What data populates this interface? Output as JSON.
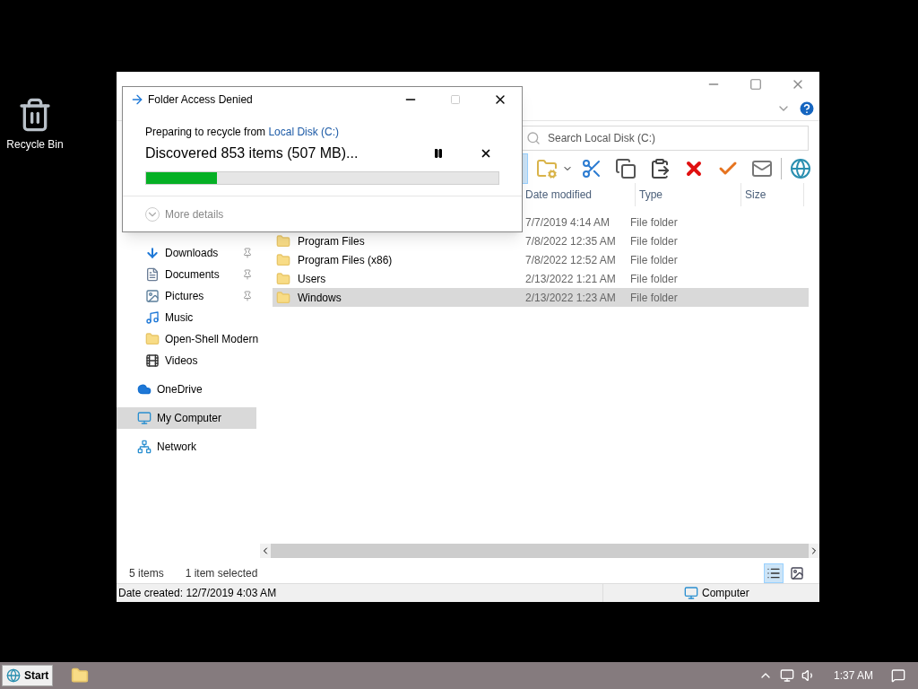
{
  "desktop_icons": [
    {
      "label": "Recycle Bin"
    }
  ],
  "explorer": {
    "search": {
      "placeholder": "Search Local Disk (C:)"
    },
    "toolbar": [
      {
        "kind": "pane",
        "selected": true
      },
      {
        "kind": "properties"
      },
      {
        "kind": "cut"
      },
      {
        "kind": "copy"
      },
      {
        "kind": "paste"
      },
      {
        "kind": "delete"
      },
      {
        "kind": "check"
      },
      {
        "kind": "mail"
      },
      {
        "kind": "globe"
      }
    ],
    "columns": [
      "Date modified",
      "Type",
      "Size"
    ],
    "sidebar": [
      {
        "label": "Downloads",
        "kind": "download",
        "pinned": true,
        "selected": false
      },
      {
        "label": "Documents",
        "kind": "document",
        "pinned": true,
        "selected": false
      },
      {
        "label": "Pictures",
        "kind": "picture",
        "pinned": true,
        "selected": false
      },
      {
        "label": "Music",
        "kind": "music",
        "pinned": false,
        "selected": false
      },
      {
        "label": "Open-Shell Modern",
        "kind": "folder",
        "pinned": false,
        "selected": false
      },
      {
        "label": "Videos",
        "kind": "video",
        "pinned": false,
        "selected": false
      },
      {
        "label": "OneDrive",
        "kind": "cloud",
        "pinned": false,
        "selected": false,
        "gap": true
      },
      {
        "label": "My Computer",
        "kind": "computer",
        "pinned": false,
        "selected": true,
        "gap": true
      },
      {
        "label": "Network",
        "kind": "network",
        "pinned": false,
        "selected": false,
        "gap": true
      }
    ],
    "rows": [
      {
        "date": "7/7/2019 4:14 AM",
        "type": "File folder",
        "selected": false
      },
      {
        "name": "Program Files",
        "date": "7/8/2022 12:35 AM",
        "type": "File folder",
        "selected": false
      },
      {
        "name": "Program Files (x86)",
        "date": "7/8/2022 12:52 AM",
        "type": "File folder",
        "selected": false
      },
      {
        "name": "Users",
        "date": "2/13/2022 1:21 AM",
        "type": "File folder",
        "selected": false
      },
      {
        "name": "Windows",
        "date": "2/13/2022 1:23 AM",
        "type": "File folder",
        "selected": true
      }
    ],
    "status": {
      "count": "5 items",
      "selection": "1 item selected",
      "view": [
        {
          "kind": "details",
          "selected": true
        },
        {
          "kind": "preview",
          "selected": false
        }
      ]
    },
    "details_bar": {
      "date_created": "Date created: 12/7/2019 4:03 AM",
      "zone": "Computer"
    }
  },
  "dialog": {
    "title": "Folder Access Denied",
    "prefix": "Preparing to recycle from ",
    "source": "Local Disk (C:)",
    "progress_text": "Discovered 853 items (507 MB)...",
    "level": 0.2,
    "more": "More details"
  },
  "taskbar": {
    "start": "Start",
    "time": "1:37 AM"
  }
}
